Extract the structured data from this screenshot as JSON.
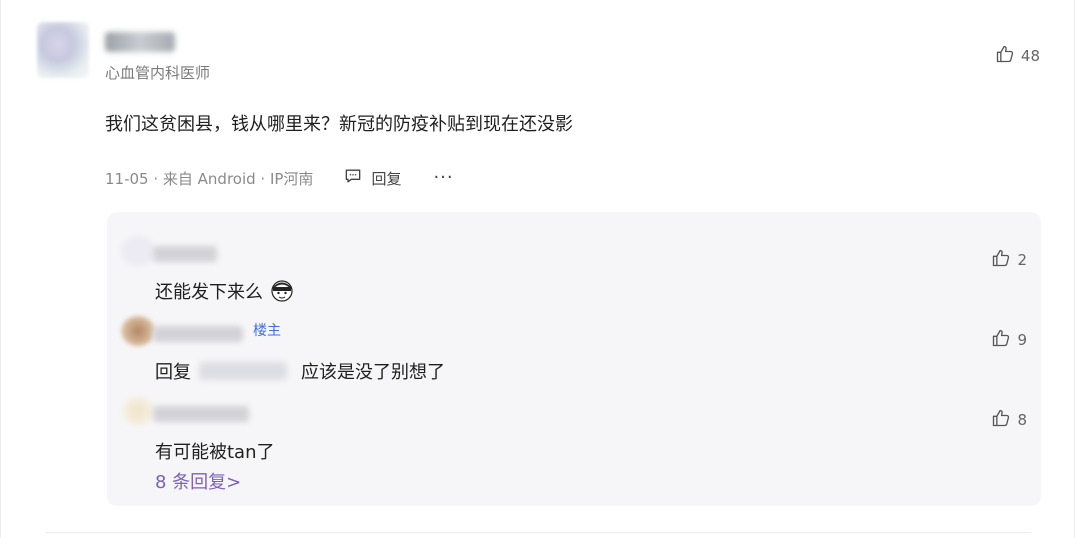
{
  "comment": {
    "author_title": "心血管内科医师",
    "like_count": "48",
    "text": "我们这贫困县，钱从哪里来？新冠的防疫补贴到现在还没影",
    "meta": "11-05 · 来自 Android · IP河南",
    "reply_label": "回复",
    "more_label": "···"
  },
  "replies": [
    {
      "text": "还能发下来么",
      "like_count": "2"
    },
    {
      "badge": "楼主",
      "prefix": "回复",
      "text": "应该是没了别想了",
      "like_count": "9"
    },
    {
      "text": "有可能被tan了",
      "like_count": "8"
    }
  ],
  "more_replies_label": "8 条回复>",
  "colors": {
    "accent_link": "#7c5fbf",
    "badge": "#3d6fe0",
    "reply_bg": "#f6f6f8"
  },
  "icons": [
    "thumbs-up-icon",
    "comment-icon",
    "more-icon",
    "emoji-icon"
  ]
}
